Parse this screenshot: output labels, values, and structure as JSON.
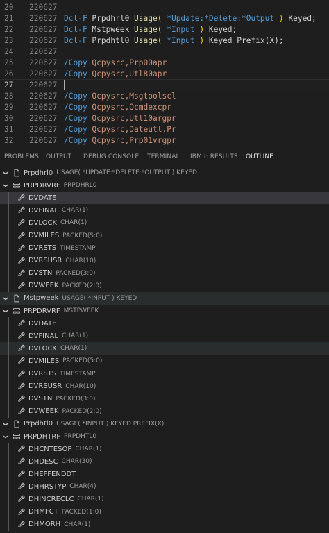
{
  "editor": {
    "lines": [
      {
        "num": "20",
        "seq": "220627",
        "tokens": []
      },
      {
        "num": "21",
        "seq": "220627",
        "tokens": [
          [
            "kw",
            "Dcl-F "
          ],
          [
            "name",
            "Prpdhrl0 "
          ],
          [
            "fn",
            "Usage"
          ],
          [
            "paren",
            "( "
          ],
          [
            "kw",
            "*Update:*Delete:*Output "
          ],
          [
            "paren",
            ")"
          ],
          [
            "name",
            " Keyed;"
          ]
        ]
      },
      {
        "num": "22",
        "seq": "220627",
        "tokens": [
          [
            "kw",
            "Dcl-F "
          ],
          [
            "name",
            "Mstpweek "
          ],
          [
            "fn",
            "Usage"
          ],
          [
            "paren",
            "( "
          ],
          [
            "kw",
            "*Input "
          ],
          [
            "paren",
            ")"
          ],
          [
            "name",
            " Keyed;"
          ]
        ]
      },
      {
        "num": "23",
        "seq": "220627",
        "tokens": [
          [
            "kw",
            "Dcl-F "
          ],
          [
            "name",
            "Prpdhtl0 "
          ],
          [
            "fn",
            "Usage"
          ],
          [
            "paren",
            "( "
          ],
          [
            "kw",
            "*Input "
          ],
          [
            "paren",
            ")"
          ],
          [
            "name",
            " Keyed Prefix(X);"
          ]
        ]
      },
      {
        "num": "24",
        "seq": "220627",
        "tokens": []
      },
      {
        "num": "25",
        "seq": "220627",
        "tokens": [
          [
            "copy",
            "/Copy "
          ],
          [
            "str",
            "Qcpysrc,Prp00apr"
          ]
        ]
      },
      {
        "num": "26",
        "seq": "220627",
        "tokens": [
          [
            "copy",
            "/Copy "
          ],
          [
            "str",
            "Qcpysrc,Utl80apr"
          ]
        ]
      },
      {
        "num": "27",
        "seq": "220627",
        "tokens": [],
        "current": true
      },
      {
        "num": "28",
        "seq": "220627",
        "tokens": [
          [
            "copy",
            "/Copy "
          ],
          [
            "str",
            "Qcpysrc,Msgtoolscl"
          ]
        ]
      },
      {
        "num": "29",
        "seq": "220627",
        "tokens": [
          [
            "copy",
            "/Copy "
          ],
          [
            "str",
            "Qcpysrc,Qcmdexcpr"
          ]
        ]
      },
      {
        "num": "30",
        "seq": "220627",
        "tokens": [
          [
            "copy",
            "/Copy "
          ],
          [
            "str",
            "Qcpysrc,Utl10argpr"
          ]
        ]
      },
      {
        "num": "31",
        "seq": "220627",
        "tokens": [
          [
            "copy",
            "/Copy "
          ],
          [
            "str",
            "Qcpysrc,Dateutl.Pr"
          ]
        ]
      },
      {
        "num": "32",
        "seq": "220627",
        "tokens": [
          [
            "copy",
            "/Copy "
          ],
          [
            "str",
            "Qcpysrc,Prp01vrgpr"
          ]
        ]
      }
    ]
  },
  "panel": {
    "tabs": [
      {
        "label": "PROBLEMS",
        "name": "tab-problems"
      },
      {
        "label": "OUTPUT",
        "name": "tab-output"
      },
      {
        "label": "DEBUG CONSOLE",
        "name": "tab-debug-console"
      },
      {
        "label": "TERMINAL",
        "name": "tab-terminal"
      },
      {
        "label": "IBM I: RESULTS",
        "name": "tab-ibmi-results"
      },
      {
        "label": "OUTLINE",
        "name": "tab-outline",
        "active": true
      }
    ]
  },
  "outline": {
    "rows": [
      {
        "level": 0,
        "icon": "file",
        "label": "Prpdhrl0",
        "desc": "USAGE( *UPDATE:*DELETE:*OUTPUT ) KEYED",
        "expanded": true
      },
      {
        "level": 1,
        "icon": "struct",
        "label": "PRPDRVRF",
        "desc": "PRPDHRL0",
        "expanded": true
      },
      {
        "level": 2,
        "icon": "field",
        "label": "DVDATE",
        "desc": "",
        "state": "selected"
      },
      {
        "level": 2,
        "icon": "field",
        "label": "DVFINAL",
        "desc": "CHAR(1)"
      },
      {
        "level": 2,
        "icon": "field",
        "label": "DVLOCK",
        "desc": "CHAR(1)"
      },
      {
        "level": 2,
        "icon": "field",
        "label": "DVMILES",
        "desc": "PACKED(5:0)"
      },
      {
        "level": 2,
        "icon": "field",
        "label": "DVRSTS",
        "desc": "TIMESTAMP"
      },
      {
        "level": 2,
        "icon": "field",
        "label": "DVRSUSR",
        "desc": "CHAR(10)"
      },
      {
        "level": 2,
        "icon": "field",
        "label": "DVSTN",
        "desc": "PACKED(3:0)"
      },
      {
        "level": 2,
        "icon": "field",
        "label": "DVWEEK",
        "desc": "PACKED(2:0)"
      },
      {
        "level": 0,
        "icon": "file",
        "label": "Mstpweek",
        "desc": "USAGE( *INPUT ) KEYED",
        "expanded": true,
        "state": "hilite"
      },
      {
        "level": 1,
        "icon": "struct",
        "label": "PRPDRVRF",
        "desc": "MSTPWEEK",
        "expanded": true
      },
      {
        "level": 2,
        "icon": "field",
        "label": "DVDATE",
        "desc": ""
      },
      {
        "level": 2,
        "icon": "field",
        "label": "DVFINAL",
        "desc": "CHAR(1)"
      },
      {
        "level": 2,
        "icon": "field",
        "label": "DVLOCK",
        "desc": "CHAR(1)",
        "state": "hilite"
      },
      {
        "level": 2,
        "icon": "field",
        "label": "DVMILES",
        "desc": "PACKED(5:0)"
      },
      {
        "level": 2,
        "icon": "field",
        "label": "DVRSTS",
        "desc": "TIMESTAMP"
      },
      {
        "level": 2,
        "icon": "field",
        "label": "DVRSUSR",
        "desc": "CHAR(10)"
      },
      {
        "level": 2,
        "icon": "field",
        "label": "DVSTN",
        "desc": "PACKED(3:0)"
      },
      {
        "level": 2,
        "icon": "field",
        "label": "DVWEEK",
        "desc": "PACKED(2:0)"
      },
      {
        "level": 0,
        "icon": "file",
        "label": "Prpdhtl0",
        "desc": "USAGE( *INPUT ) KEYED PREFIX(X)",
        "expanded": true
      },
      {
        "level": 1,
        "icon": "struct",
        "label": "PRPDHTRF",
        "desc": "PRPDHTL0",
        "expanded": true
      },
      {
        "level": 2,
        "icon": "field",
        "label": "DHCNTESOP",
        "desc": "CHAR(1)"
      },
      {
        "level": 2,
        "icon": "field",
        "label": "DHDESC",
        "desc": "CHAR(30)"
      },
      {
        "level": 2,
        "icon": "field",
        "label": "DHEFFENDDT",
        "desc": ""
      },
      {
        "level": 2,
        "icon": "field",
        "label": "DHHRSTYP",
        "desc": "CHAR(4)"
      },
      {
        "level": 2,
        "icon": "field",
        "label": "DHINCRECLC",
        "desc": "CHAR(1)"
      },
      {
        "level": 2,
        "icon": "field",
        "label": "DHMFCT",
        "desc": "PACKED(1:0)"
      },
      {
        "level": 2,
        "icon": "field",
        "label": "DHMORH",
        "desc": "CHAR(1)"
      }
    ]
  },
  "icons": {
    "file": "file-icon",
    "struct": "struct-icon",
    "field": "wrench-icon",
    "chevron": "chevron-down-icon"
  }
}
